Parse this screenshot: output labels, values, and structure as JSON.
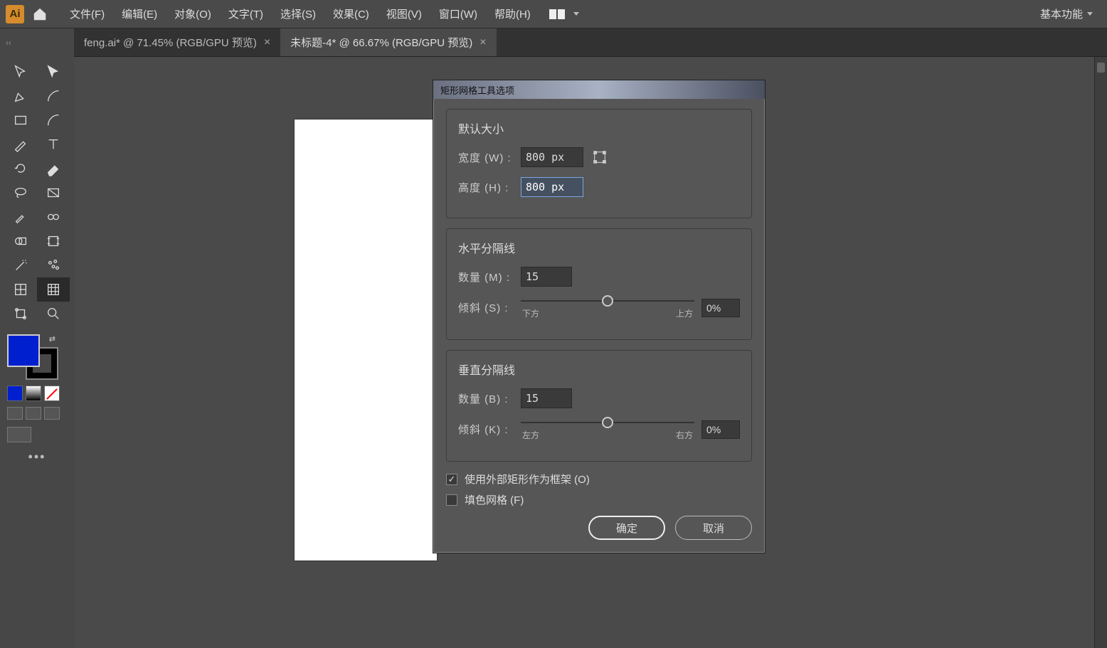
{
  "menubar": {
    "logo": "Ai",
    "items": [
      "文件(F)",
      "编辑(E)",
      "对象(O)",
      "文字(T)",
      "选择(S)",
      "效果(C)",
      "视图(V)",
      "窗口(W)",
      "帮助(H)"
    ],
    "workspace": "基本功能"
  },
  "tabs": {
    "items": [
      {
        "label": "feng.ai*  @  71.45% (RGB/GPU 预览)",
        "active": false
      },
      {
        "label": "未标题-4*  @  66.67% (RGB/GPU 预览)",
        "active": true
      }
    ]
  },
  "dialog": {
    "title": "矩形网格工具选项",
    "default_size": {
      "title": "默认大小",
      "width_label": "宽度 (W) :",
      "width_value": "800 px",
      "height_label": "高度 (H) :",
      "height_value": "800 px"
    },
    "horiz": {
      "title": "水平分隔线",
      "count_label": "数量 (M) :",
      "count_value": "15",
      "skew_label": "倾斜 (S) :",
      "skew_value": "0%",
      "left_lbl": "下方",
      "right_lbl": "上方"
    },
    "vert": {
      "title": "垂直分隔线",
      "count_label": "数量 (B) :",
      "count_value": "15",
      "skew_label": "倾斜 (K) :",
      "skew_value": "0%",
      "left_lbl": "左方",
      "right_lbl": "右方"
    },
    "opt_frame": "使用外部矩形作为框架 (O)",
    "opt_fill": "填色网格 (F)",
    "ok": "确定",
    "cancel": "取消"
  }
}
